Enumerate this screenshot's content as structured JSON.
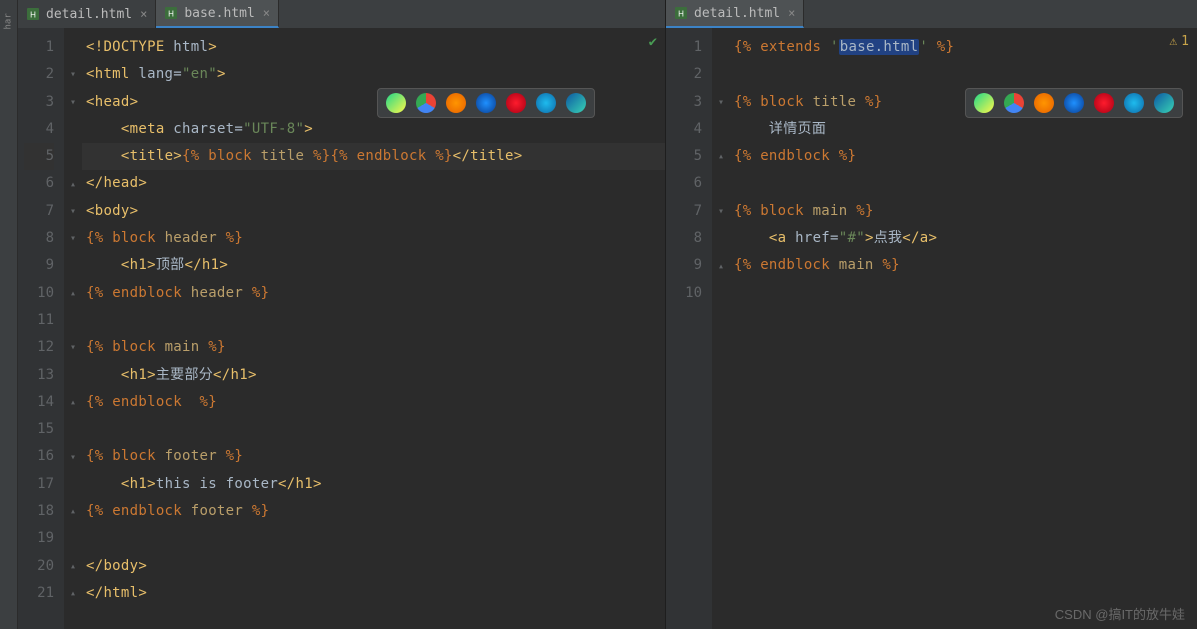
{
  "left": {
    "tabs": [
      {
        "label": "detail.html",
        "active": false
      },
      {
        "label": "base.html",
        "active": true
      }
    ],
    "lines": 21,
    "code": [
      [
        [
          "tag",
          "<!DOCTYPE "
        ],
        [
          "attr",
          "html"
        ],
        [
          "tag",
          ">"
        ]
      ],
      [
        [
          "tag",
          "<html "
        ],
        [
          "attr",
          "lang="
        ],
        [
          "str",
          "\"en\""
        ],
        [
          "tag",
          ">"
        ]
      ],
      [
        [
          "tag",
          "<head>"
        ]
      ],
      [
        [
          "text",
          "    "
        ],
        [
          "tag",
          "<meta "
        ],
        [
          "attr",
          "charset="
        ],
        [
          "str",
          "\"UTF-8\""
        ],
        [
          "tag",
          ">"
        ]
      ],
      [
        [
          "text",
          "    "
        ],
        [
          "tag",
          "<title>"
        ],
        [
          "tmpl",
          "{% "
        ],
        [
          "tmpl",
          "block "
        ],
        [
          "name",
          "title "
        ],
        [
          "tmpl",
          "%}"
        ],
        [
          "tmpl",
          "{% "
        ],
        [
          "tmpl",
          "endblock "
        ],
        [
          "tmpl",
          "%}"
        ],
        [
          "tag",
          "</title>"
        ]
      ],
      [
        [
          "tag",
          "</head>"
        ]
      ],
      [
        [
          "tag",
          "<body>"
        ]
      ],
      [
        [
          "tmpl",
          "{% "
        ],
        [
          "tmpl",
          "block "
        ],
        [
          "name",
          "header "
        ],
        [
          "tmpl",
          "%}"
        ]
      ],
      [
        [
          "text",
          "    "
        ],
        [
          "tag",
          "<h1>"
        ],
        [
          "text",
          "顶部"
        ],
        [
          "tag",
          "</h1>"
        ]
      ],
      [
        [
          "tmpl",
          "{% "
        ],
        [
          "tmpl",
          "endblock "
        ],
        [
          "name",
          "header "
        ],
        [
          "tmpl",
          "%}"
        ]
      ],
      [],
      [
        [
          "tmpl",
          "{% "
        ],
        [
          "tmpl",
          "block "
        ],
        [
          "name",
          "main "
        ],
        [
          "tmpl",
          "%}"
        ]
      ],
      [
        [
          "text",
          "    "
        ],
        [
          "tag",
          "<h1>"
        ],
        [
          "text",
          "主要部分"
        ],
        [
          "tag",
          "</h1>"
        ]
      ],
      [
        [
          "tmpl",
          "{% "
        ],
        [
          "tmpl",
          "endblock  "
        ],
        [
          "tmpl",
          "%}"
        ]
      ],
      [],
      [
        [
          "tmpl",
          "{% "
        ],
        [
          "tmpl",
          "block "
        ],
        [
          "name",
          "footer "
        ],
        [
          "tmpl",
          "%}"
        ]
      ],
      [
        [
          "text",
          "    "
        ],
        [
          "tag",
          "<h1>"
        ],
        [
          "text",
          "this is footer"
        ],
        [
          "tag",
          "</h1>"
        ]
      ],
      [
        [
          "tmpl",
          "{% "
        ],
        [
          "tmpl",
          "endblock "
        ],
        [
          "name",
          "footer "
        ],
        [
          "tmpl",
          "%}"
        ]
      ],
      [],
      [
        [
          "tag",
          "</body>"
        ]
      ],
      [
        [
          "tag",
          "</html>"
        ]
      ]
    ],
    "fold": {
      "2": "down",
      "3": "down",
      "6": "up",
      "7": "down",
      "8": "down",
      "10": "up",
      "12": "down",
      "14": "up",
      "16": "down",
      "18": "up",
      "20": "up",
      "21": "up"
    },
    "highlight_line": 5
  },
  "right": {
    "tabs": [
      {
        "label": "detail.html",
        "active": true
      }
    ],
    "lines": 10,
    "warning_count": "1",
    "code": [
      [
        [
          "tmpl",
          "{% "
        ],
        [
          "tmpl",
          "extends "
        ],
        [
          "str",
          "'"
        ],
        [
          "hl",
          "base.html"
        ],
        [
          "str",
          "' "
        ],
        [
          "tmpl",
          "%}"
        ]
      ],
      [],
      [
        [
          "tmpl",
          "{% "
        ],
        [
          "tmpl",
          "block "
        ],
        [
          "name",
          "title "
        ],
        [
          "tmpl",
          "%}"
        ]
      ],
      [
        [
          "text",
          "    详情页面"
        ]
      ],
      [
        [
          "tmpl",
          "{% "
        ],
        [
          "tmpl",
          "endblock "
        ],
        [
          "tmpl",
          "%}"
        ]
      ],
      [],
      [
        [
          "tmpl",
          "{% "
        ],
        [
          "tmpl",
          "block "
        ],
        [
          "name",
          "main "
        ],
        [
          "tmpl",
          "%}"
        ]
      ],
      [
        [
          "text",
          "    "
        ],
        [
          "tag",
          "<a "
        ],
        [
          "attr",
          "href="
        ],
        [
          "str",
          "\"#\""
        ],
        [
          "tag",
          ">"
        ],
        [
          "text",
          "点我"
        ],
        [
          "tag",
          "</a>"
        ]
      ],
      [
        [
          "tmpl",
          "{% "
        ],
        [
          "tmpl",
          "endblock "
        ],
        [
          "name",
          "main "
        ],
        [
          "tmpl",
          "%}"
        ]
      ],
      []
    ],
    "fold": {
      "3": "down",
      "5": "up",
      "7": "down",
      "9": "up"
    }
  },
  "browser_icons": [
    {
      "name": "pycharm-icon",
      "bg": "linear-gradient(135deg,#21d789,#fcf84a)"
    },
    {
      "name": "chrome-icon",
      "bg": "conic-gradient(#ea4335 0 120deg,#4285f4 120deg 240deg,#34a853 240deg 360deg)"
    },
    {
      "name": "firefox-icon",
      "bg": "radial-gradient(circle,#ff9500,#e66000)"
    },
    {
      "name": "safari-icon",
      "bg": "radial-gradient(circle,#1e90ff,#0a3d91)"
    },
    {
      "name": "opera-icon",
      "bg": "radial-gradient(circle,#ff1b2d,#a70014)"
    },
    {
      "name": "ie-icon",
      "bg": "radial-gradient(circle,#1ebbee,#0e6aa8)"
    },
    {
      "name": "edge-icon",
      "bg": "linear-gradient(135deg,#0c59a4,#39d2b4)"
    }
  ],
  "watermark": "CSDN @搞IT的放牛娃",
  "side_strip_label": "har"
}
